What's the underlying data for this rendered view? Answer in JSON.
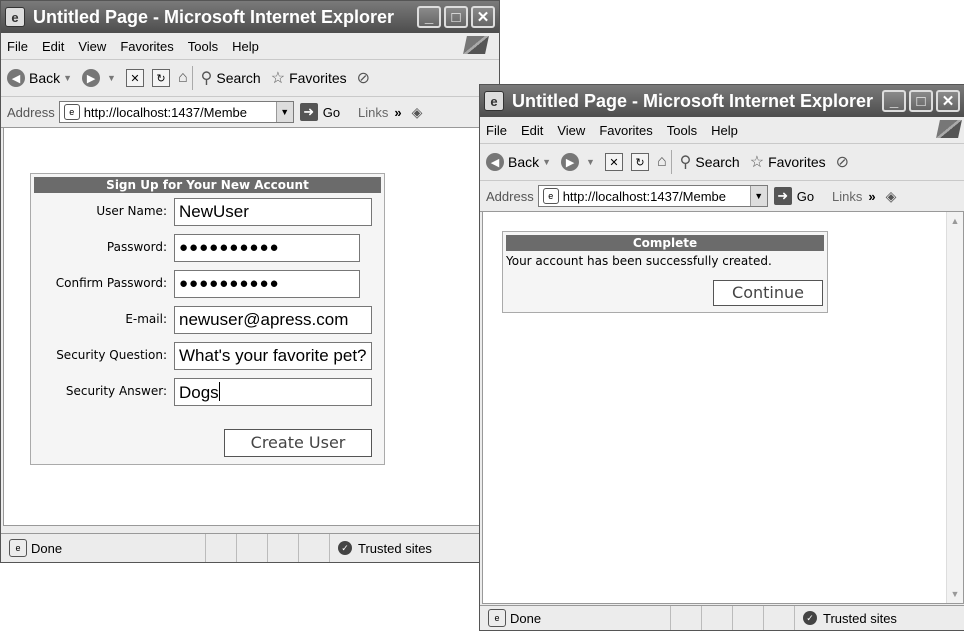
{
  "window1": {
    "title": "Untitled Page - Microsoft Internet Explorer",
    "menu": [
      "File",
      "Edit",
      "View",
      "Favorites",
      "Tools",
      "Help"
    ],
    "toolbar": {
      "back": "Back",
      "search": "Search",
      "favorites": "Favorites"
    },
    "address": {
      "label": "Address",
      "url": "http://localhost:1437/Membe",
      "go": "Go",
      "links": "Links"
    },
    "status": {
      "text": "Done",
      "zone": "Trusted sites"
    },
    "wizard": {
      "title": "Sign Up for Your New Account",
      "fields": [
        {
          "label": "User Name:",
          "value": "NewUser"
        },
        {
          "label": "Password:",
          "value": "●●●●●●●●●●"
        },
        {
          "label": "Confirm Password:",
          "value": "●●●●●●●●●●"
        },
        {
          "label": "E-mail:",
          "value": "newuser@apress.com"
        },
        {
          "label": "Security Question:",
          "value": "What's your favorite pet?"
        },
        {
          "label": "Security Answer:",
          "value": "Dogs"
        }
      ],
      "create_button": "Create User"
    }
  },
  "window2": {
    "title": "Untitled Page - Microsoft Internet Explorer",
    "menu": [
      "File",
      "Edit",
      "View",
      "Favorites",
      "Tools",
      "Help"
    ],
    "toolbar": {
      "back": "Back",
      "search": "Search",
      "favorites": "Favorites"
    },
    "address": {
      "label": "Address",
      "url": "http://localhost:1437/Membe",
      "go": "Go",
      "links": "Links"
    },
    "status": {
      "text": "Done",
      "zone": "Trusted sites"
    },
    "complete": {
      "title": "Complete",
      "message": "Your account has been successfully created.",
      "continue_button": "Continue"
    }
  }
}
